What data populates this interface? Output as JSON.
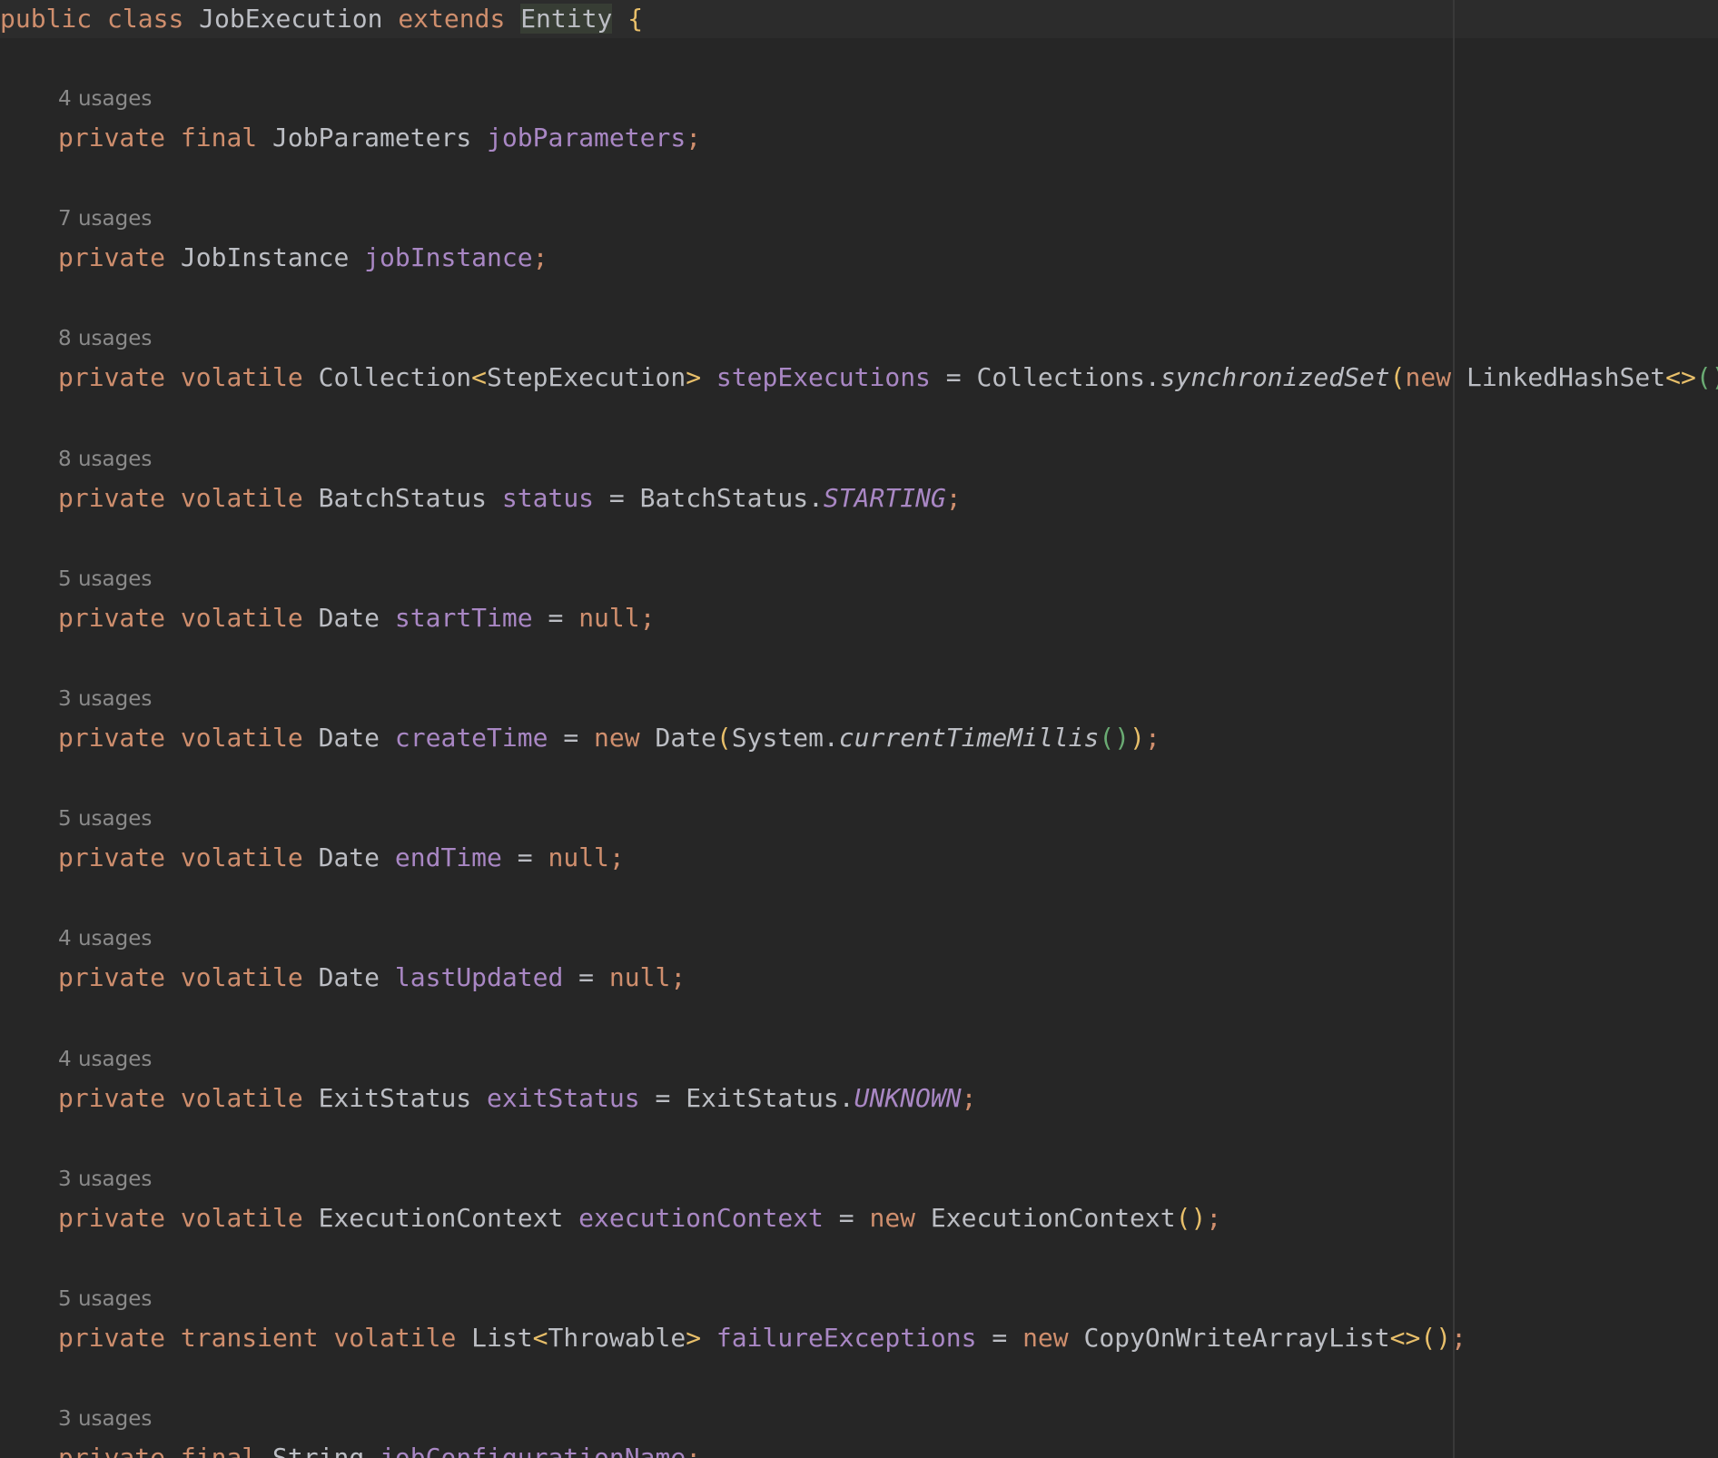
{
  "editor": {
    "class_decl": {
      "k1": "public",
      "k2": "class",
      "name": "JobExecution",
      "k3": "extends",
      "parent": "Entity",
      "brace": "{"
    },
    "fields": [
      {
        "usages": "4 usages",
        "tokens": [
          {
            "t": "private",
            "s": "kw"
          },
          {
            "t": " ",
            "s": "op"
          },
          {
            "t": "final",
            "s": "kw"
          },
          {
            "t": " ",
            "s": "op"
          },
          {
            "t": "JobParameters",
            "s": "tp"
          },
          {
            "t": " ",
            "s": "op"
          },
          {
            "t": "jobParameters",
            "s": "fld"
          },
          {
            "t": ";",
            "s": "sm"
          }
        ]
      },
      {
        "usages": "7 usages",
        "tokens": [
          {
            "t": "private",
            "s": "kw"
          },
          {
            "t": " ",
            "s": "op"
          },
          {
            "t": "JobInstance",
            "s": "tp"
          },
          {
            "t": " ",
            "s": "op"
          },
          {
            "t": "jobInstance",
            "s": "fld"
          },
          {
            "t": ";",
            "s": "sm"
          }
        ]
      },
      {
        "usages": "8 usages",
        "tokens": [
          {
            "t": "private",
            "s": "kw"
          },
          {
            "t": " ",
            "s": "op"
          },
          {
            "t": "volatile",
            "s": "kw"
          },
          {
            "t": " ",
            "s": "op"
          },
          {
            "t": "Collection",
            "s": "tp"
          },
          {
            "t": "<",
            "s": "ang"
          },
          {
            "t": "StepExecution",
            "s": "tp"
          },
          {
            "t": ">",
            "s": "ang"
          },
          {
            "t": " ",
            "s": "op"
          },
          {
            "t": "stepExecutions",
            "s": "fld"
          },
          {
            "t": " = ",
            "s": "op"
          },
          {
            "t": "Collections.",
            "s": "tp"
          },
          {
            "t": "synchronizedSet",
            "s": "mth"
          },
          {
            "t": "(",
            "s": "p1"
          },
          {
            "t": "new",
            "s": "kw"
          },
          {
            "t": " ",
            "s": "op"
          },
          {
            "t": "LinkedHashSet",
            "s": "tp"
          },
          {
            "t": "<>",
            "s": "ang"
          },
          {
            "t": "()",
            "s": "p2"
          },
          {
            "t": ")",
            "s": "p1"
          },
          {
            "t": ";",
            "s": "sm"
          }
        ]
      },
      {
        "usages": "8 usages",
        "tokens": [
          {
            "t": "private",
            "s": "kw"
          },
          {
            "t": " ",
            "s": "op"
          },
          {
            "t": "volatile",
            "s": "kw"
          },
          {
            "t": " ",
            "s": "op"
          },
          {
            "t": "BatchStatus",
            "s": "tp"
          },
          {
            "t": " ",
            "s": "op"
          },
          {
            "t": "status",
            "s": "fld"
          },
          {
            "t": " = ",
            "s": "op"
          },
          {
            "t": "BatchStatus.",
            "s": "tp"
          },
          {
            "t": "STARTING",
            "s": "st"
          },
          {
            "t": ";",
            "s": "sm"
          }
        ]
      },
      {
        "usages": "5 usages",
        "tokens": [
          {
            "t": "private",
            "s": "kw"
          },
          {
            "t": " ",
            "s": "op"
          },
          {
            "t": "volatile",
            "s": "kw"
          },
          {
            "t": " ",
            "s": "op"
          },
          {
            "t": "Date",
            "s": "tp"
          },
          {
            "t": " ",
            "s": "op"
          },
          {
            "t": "startTime",
            "s": "fld"
          },
          {
            "t": " = ",
            "s": "op"
          },
          {
            "t": "null",
            "s": "kw"
          },
          {
            "t": ";",
            "s": "sm"
          }
        ]
      },
      {
        "usages": "3 usages",
        "tokens": [
          {
            "t": "private",
            "s": "kw"
          },
          {
            "t": " ",
            "s": "op"
          },
          {
            "t": "volatile",
            "s": "kw"
          },
          {
            "t": " ",
            "s": "op"
          },
          {
            "t": "Date",
            "s": "tp"
          },
          {
            "t": " ",
            "s": "op"
          },
          {
            "t": "createTime",
            "s": "fld"
          },
          {
            "t": " = ",
            "s": "op"
          },
          {
            "t": "new",
            "s": "kw"
          },
          {
            "t": " ",
            "s": "op"
          },
          {
            "t": "Date",
            "s": "tp"
          },
          {
            "t": "(",
            "s": "p1"
          },
          {
            "t": "System.",
            "s": "tp"
          },
          {
            "t": "currentTimeMillis",
            "s": "mth"
          },
          {
            "t": "()",
            "s": "p2"
          },
          {
            "t": ")",
            "s": "p1"
          },
          {
            "t": ";",
            "s": "sm"
          }
        ]
      },
      {
        "usages": "5 usages",
        "tokens": [
          {
            "t": "private",
            "s": "kw"
          },
          {
            "t": " ",
            "s": "op"
          },
          {
            "t": "volatile",
            "s": "kw"
          },
          {
            "t": " ",
            "s": "op"
          },
          {
            "t": "Date",
            "s": "tp"
          },
          {
            "t": " ",
            "s": "op"
          },
          {
            "t": "endTime",
            "s": "fld"
          },
          {
            "t": " = ",
            "s": "op"
          },
          {
            "t": "null",
            "s": "kw"
          },
          {
            "t": ";",
            "s": "sm"
          }
        ]
      },
      {
        "usages": "4 usages",
        "tokens": [
          {
            "t": "private",
            "s": "kw"
          },
          {
            "t": " ",
            "s": "op"
          },
          {
            "t": "volatile",
            "s": "kw"
          },
          {
            "t": " ",
            "s": "op"
          },
          {
            "t": "Date",
            "s": "tp"
          },
          {
            "t": " ",
            "s": "op"
          },
          {
            "t": "lastUpdated",
            "s": "fld"
          },
          {
            "t": " = ",
            "s": "op"
          },
          {
            "t": "null",
            "s": "kw"
          },
          {
            "t": ";",
            "s": "sm"
          }
        ]
      },
      {
        "usages": "4 usages",
        "tokens": [
          {
            "t": "private",
            "s": "kw"
          },
          {
            "t": " ",
            "s": "op"
          },
          {
            "t": "volatile",
            "s": "kw"
          },
          {
            "t": " ",
            "s": "op"
          },
          {
            "t": "ExitStatus",
            "s": "tp"
          },
          {
            "t": " ",
            "s": "op"
          },
          {
            "t": "exitStatus",
            "s": "fld"
          },
          {
            "t": " = ",
            "s": "op"
          },
          {
            "t": "ExitStatus.",
            "s": "tp"
          },
          {
            "t": "UNKNOWN",
            "s": "st"
          },
          {
            "t": ";",
            "s": "sm"
          }
        ]
      },
      {
        "usages": "3 usages",
        "tokens": [
          {
            "t": "private",
            "s": "kw"
          },
          {
            "t": " ",
            "s": "op"
          },
          {
            "t": "volatile",
            "s": "kw"
          },
          {
            "t": " ",
            "s": "op"
          },
          {
            "t": "ExecutionContext",
            "s": "tp"
          },
          {
            "t": " ",
            "s": "op"
          },
          {
            "t": "executionContext",
            "s": "fld"
          },
          {
            "t": " = ",
            "s": "op"
          },
          {
            "t": "new",
            "s": "kw"
          },
          {
            "t": " ",
            "s": "op"
          },
          {
            "t": "ExecutionContext",
            "s": "tp"
          },
          {
            "t": "()",
            "s": "p1"
          },
          {
            "t": ";",
            "s": "sm"
          }
        ]
      },
      {
        "usages": "5 usages",
        "tokens": [
          {
            "t": "private",
            "s": "kw"
          },
          {
            "t": " ",
            "s": "op"
          },
          {
            "t": "transient",
            "s": "kw"
          },
          {
            "t": " ",
            "s": "op"
          },
          {
            "t": "volatile",
            "s": "kw"
          },
          {
            "t": " ",
            "s": "op"
          },
          {
            "t": "List",
            "s": "tp"
          },
          {
            "t": "<",
            "s": "ang"
          },
          {
            "t": "Throwable",
            "s": "tp"
          },
          {
            "t": ">",
            "s": "ang"
          },
          {
            "t": " ",
            "s": "op"
          },
          {
            "t": "failureExceptions",
            "s": "fld"
          },
          {
            "t": " = ",
            "s": "op"
          },
          {
            "t": "new",
            "s": "kw"
          },
          {
            "t": " ",
            "s": "op"
          },
          {
            "t": "CopyOnWriteArrayList",
            "s": "tp"
          },
          {
            "t": "<>",
            "s": "ang"
          },
          {
            "t": "()",
            "s": "p1"
          },
          {
            "t": ";",
            "s": "sm"
          }
        ]
      },
      {
        "usages": "3 usages",
        "tokens": [
          {
            "t": "private",
            "s": "kw"
          },
          {
            "t": " ",
            "s": "op"
          },
          {
            "t": "final",
            "s": "kw"
          },
          {
            "t": " ",
            "s": "op"
          },
          {
            "t": "String",
            "s": "tp"
          },
          {
            "t": " ",
            "s": "op"
          },
          {
            "t": "jobConfigurationName",
            "s": "fld"
          },
          {
            "t": ";",
            "s": "sm"
          }
        ]
      }
    ]
  }
}
